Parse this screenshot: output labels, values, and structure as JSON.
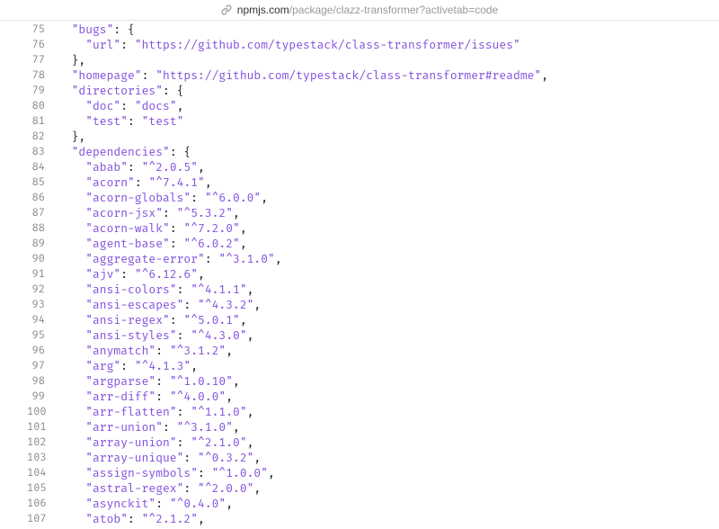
{
  "url": {
    "host": "npmjs.com",
    "path": "/package/clazz-transformer?activetab=code"
  },
  "lines": [
    {
      "n": 75,
      "indent": 2,
      "tokens": [
        {
          "t": "key",
          "v": "\"bugs\""
        },
        {
          "t": "pct",
          "v": ": {"
        }
      ]
    },
    {
      "n": 76,
      "indent": 4,
      "tokens": [
        {
          "t": "key",
          "v": "\"url\""
        },
        {
          "t": "pct",
          "v": ": "
        },
        {
          "t": "str",
          "v": "\"https://github.com/typestack/class-transformer/issues\""
        }
      ]
    },
    {
      "n": 77,
      "indent": 2,
      "tokens": [
        {
          "t": "pct",
          "v": "},"
        }
      ]
    },
    {
      "n": 78,
      "indent": 2,
      "tokens": [
        {
          "t": "key",
          "v": "\"homepage\""
        },
        {
          "t": "pct",
          "v": ": "
        },
        {
          "t": "str",
          "v": "\"https://github.com/typestack/class-transformer#readme\""
        },
        {
          "t": "pct",
          "v": ","
        }
      ]
    },
    {
      "n": 79,
      "indent": 2,
      "tokens": [
        {
          "t": "key",
          "v": "\"directories\""
        },
        {
          "t": "pct",
          "v": ": {"
        }
      ]
    },
    {
      "n": 80,
      "indent": 4,
      "tokens": [
        {
          "t": "key",
          "v": "\"doc\""
        },
        {
          "t": "pct",
          "v": ": "
        },
        {
          "t": "str",
          "v": "\"docs\""
        },
        {
          "t": "pct",
          "v": ","
        }
      ]
    },
    {
      "n": 81,
      "indent": 4,
      "tokens": [
        {
          "t": "key",
          "v": "\"test\""
        },
        {
          "t": "pct",
          "v": ": "
        },
        {
          "t": "str",
          "v": "\"test\""
        }
      ]
    },
    {
      "n": 82,
      "indent": 2,
      "tokens": [
        {
          "t": "pct",
          "v": "},"
        }
      ]
    },
    {
      "n": 83,
      "indent": 2,
      "tokens": [
        {
          "t": "key",
          "v": "\"dependencies\""
        },
        {
          "t": "pct",
          "v": ": {"
        }
      ]
    },
    {
      "n": 84,
      "indent": 4,
      "tokens": [
        {
          "t": "key",
          "v": "\"abab\""
        },
        {
          "t": "pct",
          "v": ": "
        },
        {
          "t": "str",
          "v": "\"^2.0.5\""
        },
        {
          "t": "pct",
          "v": ","
        }
      ]
    },
    {
      "n": 85,
      "indent": 4,
      "tokens": [
        {
          "t": "key",
          "v": "\"acorn\""
        },
        {
          "t": "pct",
          "v": ": "
        },
        {
          "t": "str",
          "v": "\"^7.4.1\""
        },
        {
          "t": "pct",
          "v": ","
        }
      ]
    },
    {
      "n": 86,
      "indent": 4,
      "tokens": [
        {
          "t": "key",
          "v": "\"acorn-globals\""
        },
        {
          "t": "pct",
          "v": ": "
        },
        {
          "t": "str",
          "v": "\"^6.0.0\""
        },
        {
          "t": "pct",
          "v": ","
        }
      ]
    },
    {
      "n": 87,
      "indent": 4,
      "tokens": [
        {
          "t": "key",
          "v": "\"acorn-jsx\""
        },
        {
          "t": "pct",
          "v": ": "
        },
        {
          "t": "str",
          "v": "\"^5.3.2\""
        },
        {
          "t": "pct",
          "v": ","
        }
      ]
    },
    {
      "n": 88,
      "indent": 4,
      "tokens": [
        {
          "t": "key",
          "v": "\"acorn-walk\""
        },
        {
          "t": "pct",
          "v": ": "
        },
        {
          "t": "str",
          "v": "\"^7.2.0\""
        },
        {
          "t": "pct",
          "v": ","
        }
      ]
    },
    {
      "n": 89,
      "indent": 4,
      "tokens": [
        {
          "t": "key",
          "v": "\"agent-base\""
        },
        {
          "t": "pct",
          "v": ": "
        },
        {
          "t": "str",
          "v": "\"^6.0.2\""
        },
        {
          "t": "pct",
          "v": ","
        }
      ]
    },
    {
      "n": 90,
      "indent": 4,
      "tokens": [
        {
          "t": "key",
          "v": "\"aggregate-error\""
        },
        {
          "t": "pct",
          "v": ": "
        },
        {
          "t": "str",
          "v": "\"^3.1.0\""
        },
        {
          "t": "pct",
          "v": ","
        }
      ]
    },
    {
      "n": 91,
      "indent": 4,
      "tokens": [
        {
          "t": "key",
          "v": "\"ajv\""
        },
        {
          "t": "pct",
          "v": ": "
        },
        {
          "t": "str",
          "v": "\"^6.12.6\""
        },
        {
          "t": "pct",
          "v": ","
        }
      ]
    },
    {
      "n": 92,
      "indent": 4,
      "tokens": [
        {
          "t": "key",
          "v": "\"ansi-colors\""
        },
        {
          "t": "pct",
          "v": ": "
        },
        {
          "t": "str",
          "v": "\"^4.1.1\""
        },
        {
          "t": "pct",
          "v": ","
        }
      ]
    },
    {
      "n": 93,
      "indent": 4,
      "tokens": [
        {
          "t": "key",
          "v": "\"ansi-escapes\""
        },
        {
          "t": "pct",
          "v": ": "
        },
        {
          "t": "str",
          "v": "\"^4.3.2\""
        },
        {
          "t": "pct",
          "v": ","
        }
      ]
    },
    {
      "n": 94,
      "indent": 4,
      "tokens": [
        {
          "t": "key",
          "v": "\"ansi-regex\""
        },
        {
          "t": "pct",
          "v": ": "
        },
        {
          "t": "str",
          "v": "\"^5.0.1\""
        },
        {
          "t": "pct",
          "v": ","
        }
      ]
    },
    {
      "n": 95,
      "indent": 4,
      "tokens": [
        {
          "t": "key",
          "v": "\"ansi-styles\""
        },
        {
          "t": "pct",
          "v": ": "
        },
        {
          "t": "str",
          "v": "\"^4.3.0\""
        },
        {
          "t": "pct",
          "v": ","
        }
      ]
    },
    {
      "n": 96,
      "indent": 4,
      "tokens": [
        {
          "t": "key",
          "v": "\"anymatch\""
        },
        {
          "t": "pct",
          "v": ": "
        },
        {
          "t": "str",
          "v": "\"^3.1.2\""
        },
        {
          "t": "pct",
          "v": ","
        }
      ]
    },
    {
      "n": 97,
      "indent": 4,
      "tokens": [
        {
          "t": "key",
          "v": "\"arg\""
        },
        {
          "t": "pct",
          "v": ": "
        },
        {
          "t": "str",
          "v": "\"^4.1.3\""
        },
        {
          "t": "pct",
          "v": ","
        }
      ]
    },
    {
      "n": 98,
      "indent": 4,
      "tokens": [
        {
          "t": "key",
          "v": "\"argparse\""
        },
        {
          "t": "pct",
          "v": ": "
        },
        {
          "t": "str",
          "v": "\"^1.0.10\""
        },
        {
          "t": "pct",
          "v": ","
        }
      ]
    },
    {
      "n": 99,
      "indent": 4,
      "tokens": [
        {
          "t": "key",
          "v": "\"arr-diff\""
        },
        {
          "t": "pct",
          "v": ": "
        },
        {
          "t": "str",
          "v": "\"^4.0.0\""
        },
        {
          "t": "pct",
          "v": ","
        }
      ]
    },
    {
      "n": 100,
      "indent": 4,
      "tokens": [
        {
          "t": "key",
          "v": "\"arr-flatten\""
        },
        {
          "t": "pct",
          "v": ": "
        },
        {
          "t": "str",
          "v": "\"^1.1.0\""
        },
        {
          "t": "pct",
          "v": ","
        }
      ]
    },
    {
      "n": 101,
      "indent": 4,
      "tokens": [
        {
          "t": "key",
          "v": "\"arr-union\""
        },
        {
          "t": "pct",
          "v": ": "
        },
        {
          "t": "str",
          "v": "\"^3.1.0\""
        },
        {
          "t": "pct",
          "v": ","
        }
      ]
    },
    {
      "n": 102,
      "indent": 4,
      "tokens": [
        {
          "t": "key",
          "v": "\"array-union\""
        },
        {
          "t": "pct",
          "v": ": "
        },
        {
          "t": "str",
          "v": "\"^2.1.0\""
        },
        {
          "t": "pct",
          "v": ","
        }
      ]
    },
    {
      "n": 103,
      "indent": 4,
      "tokens": [
        {
          "t": "key",
          "v": "\"array-unique\""
        },
        {
          "t": "pct",
          "v": ": "
        },
        {
          "t": "str",
          "v": "\"^0.3.2\""
        },
        {
          "t": "pct",
          "v": ","
        }
      ]
    },
    {
      "n": 104,
      "indent": 4,
      "tokens": [
        {
          "t": "key",
          "v": "\"assign-symbols\""
        },
        {
          "t": "pct",
          "v": ": "
        },
        {
          "t": "str",
          "v": "\"^1.0.0\""
        },
        {
          "t": "pct",
          "v": ","
        }
      ]
    },
    {
      "n": 105,
      "indent": 4,
      "tokens": [
        {
          "t": "key",
          "v": "\"astral-regex\""
        },
        {
          "t": "pct",
          "v": ": "
        },
        {
          "t": "str",
          "v": "\"^2.0.0\""
        },
        {
          "t": "pct",
          "v": ","
        }
      ]
    },
    {
      "n": 106,
      "indent": 4,
      "tokens": [
        {
          "t": "key",
          "v": "\"asynckit\""
        },
        {
          "t": "pct",
          "v": ": "
        },
        {
          "t": "str",
          "v": "\"^0.4.0\""
        },
        {
          "t": "pct",
          "v": ","
        }
      ]
    },
    {
      "n": 107,
      "indent": 4,
      "tokens": [
        {
          "t": "key",
          "v": "\"atob\""
        },
        {
          "t": "pct",
          "v": ": "
        },
        {
          "t": "str",
          "v": "\"^2.1.2\""
        },
        {
          "t": "pct",
          "v": ","
        }
      ]
    }
  ]
}
